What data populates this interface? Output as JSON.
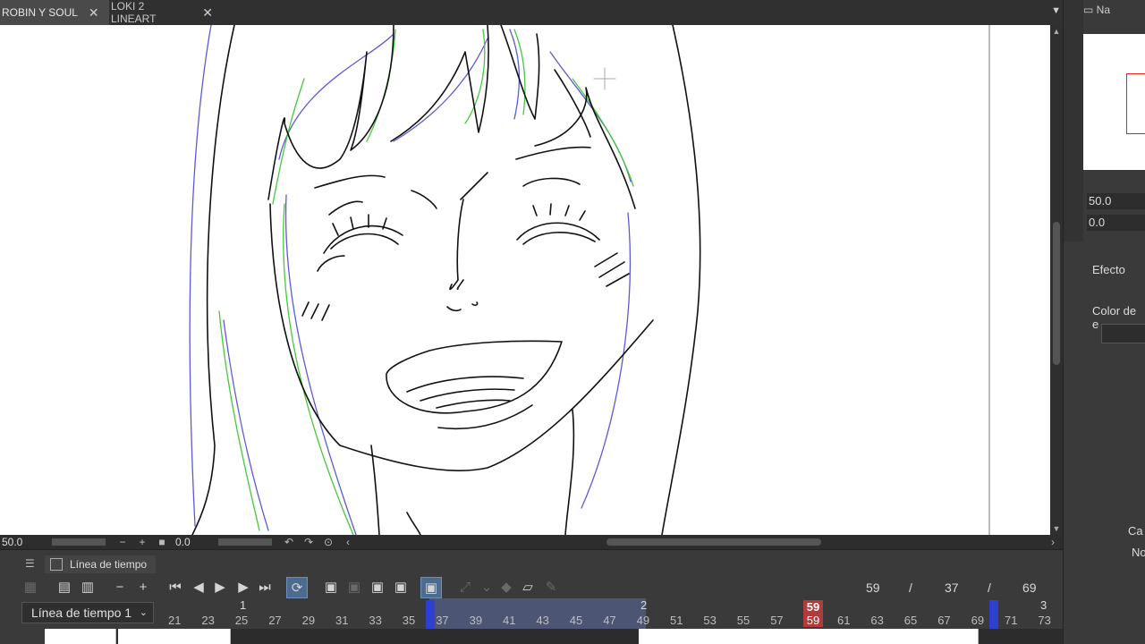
{
  "tabs": [
    {
      "label": "ROBIN Y SOUL",
      "close": "✕",
      "active": true
    },
    {
      "label": "LOKI 2 LINEART",
      "close": "✕",
      "active": false
    }
  ],
  "status": {
    "zoom": "50.0",
    "angle": "0.0",
    "zoom_out": "−",
    "zoom_in": "+",
    "reset": "■"
  },
  "timeline": {
    "tab_label": "Línea de tiempo",
    "selector": "Línea de tiempo 1",
    "counter": {
      "current": "59",
      "sep1": "/",
      "total": "37",
      "sep2": "/",
      "end": "69"
    },
    "ruler_ticks": [
      "21",
      "23",
      "25",
      "27",
      "29",
      "31",
      "33",
      "35",
      "37",
      "39",
      "41",
      "43",
      "45",
      "47",
      "49",
      "51",
      "53",
      "55",
      "57",
      "59",
      "61",
      "63",
      "65",
      "67",
      "69",
      "71",
      "73"
    ],
    "scene_marks": [
      "1",
      "2",
      "3"
    ],
    "current_frame_top": "59",
    "current_frame_bottom": "59"
  },
  "dock": {
    "navigator_label": "Na",
    "zoom_value": "50.0",
    "rotate_value": "0.0",
    "effect_label": "Efecto",
    "color_label": "Color de e",
    "layer_label": "Ca",
    "blend_label": "No"
  },
  "colors": {
    "accent_blue": "#2f3fd0",
    "current_frame": "#b13a3a",
    "onion_green": "#46c93a",
    "onion_blue": "#5b5bd6"
  }
}
